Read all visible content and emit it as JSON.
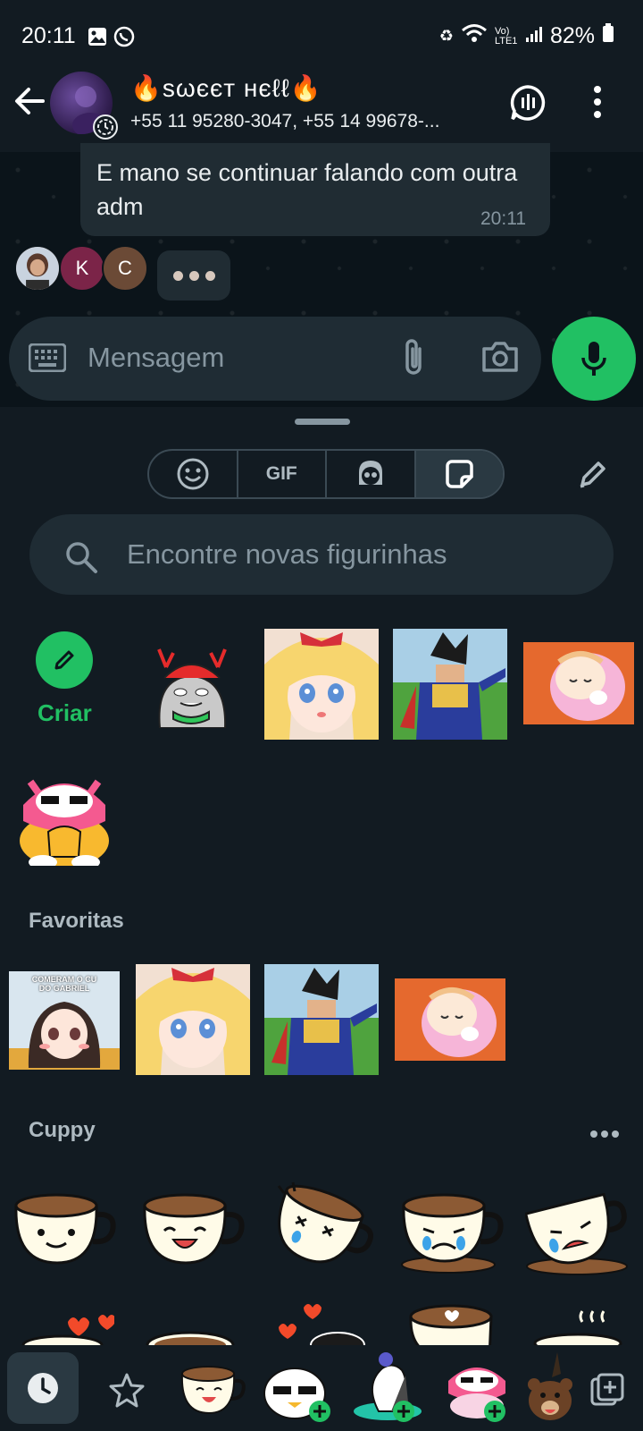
{
  "status_bar": {
    "time": "20:11",
    "battery": "82%",
    "network": "Vo) LTE1"
  },
  "header": {
    "title": "🔥ѕωєєт нєℓℓ🔥",
    "subtitle": "+55 11 95280-3047, +55 14 99678-..."
  },
  "chat": {
    "message_text": "E mano se continuar falando com outra adm",
    "message_time": "20:11",
    "typing_avatars": [
      {
        "letter": "",
        "color": "#8a6a5a"
      },
      {
        "letter": "K",
        "color": "#7b2448"
      },
      {
        "letter": "C",
        "color": "#6b4a36"
      }
    ]
  },
  "input": {
    "placeholder": "Mensagem"
  },
  "sticker_panel": {
    "tabs": [
      "emoji-icon",
      "GIF",
      "avatar-icon",
      "sticker-icon"
    ],
    "gif_label": "GIF",
    "search_placeholder": "Encontre novas figurinhas",
    "create_label": "Criar",
    "favorites_label": "Favoritas",
    "pack_label": "Cuppy",
    "favorite_sticker_text": "COMERAM O CU DO GABRIEL"
  },
  "colors": {
    "accent": "#21c063",
    "background": "#121b22",
    "chat_bg": "#0b141a",
    "bubble": "#202c33"
  }
}
